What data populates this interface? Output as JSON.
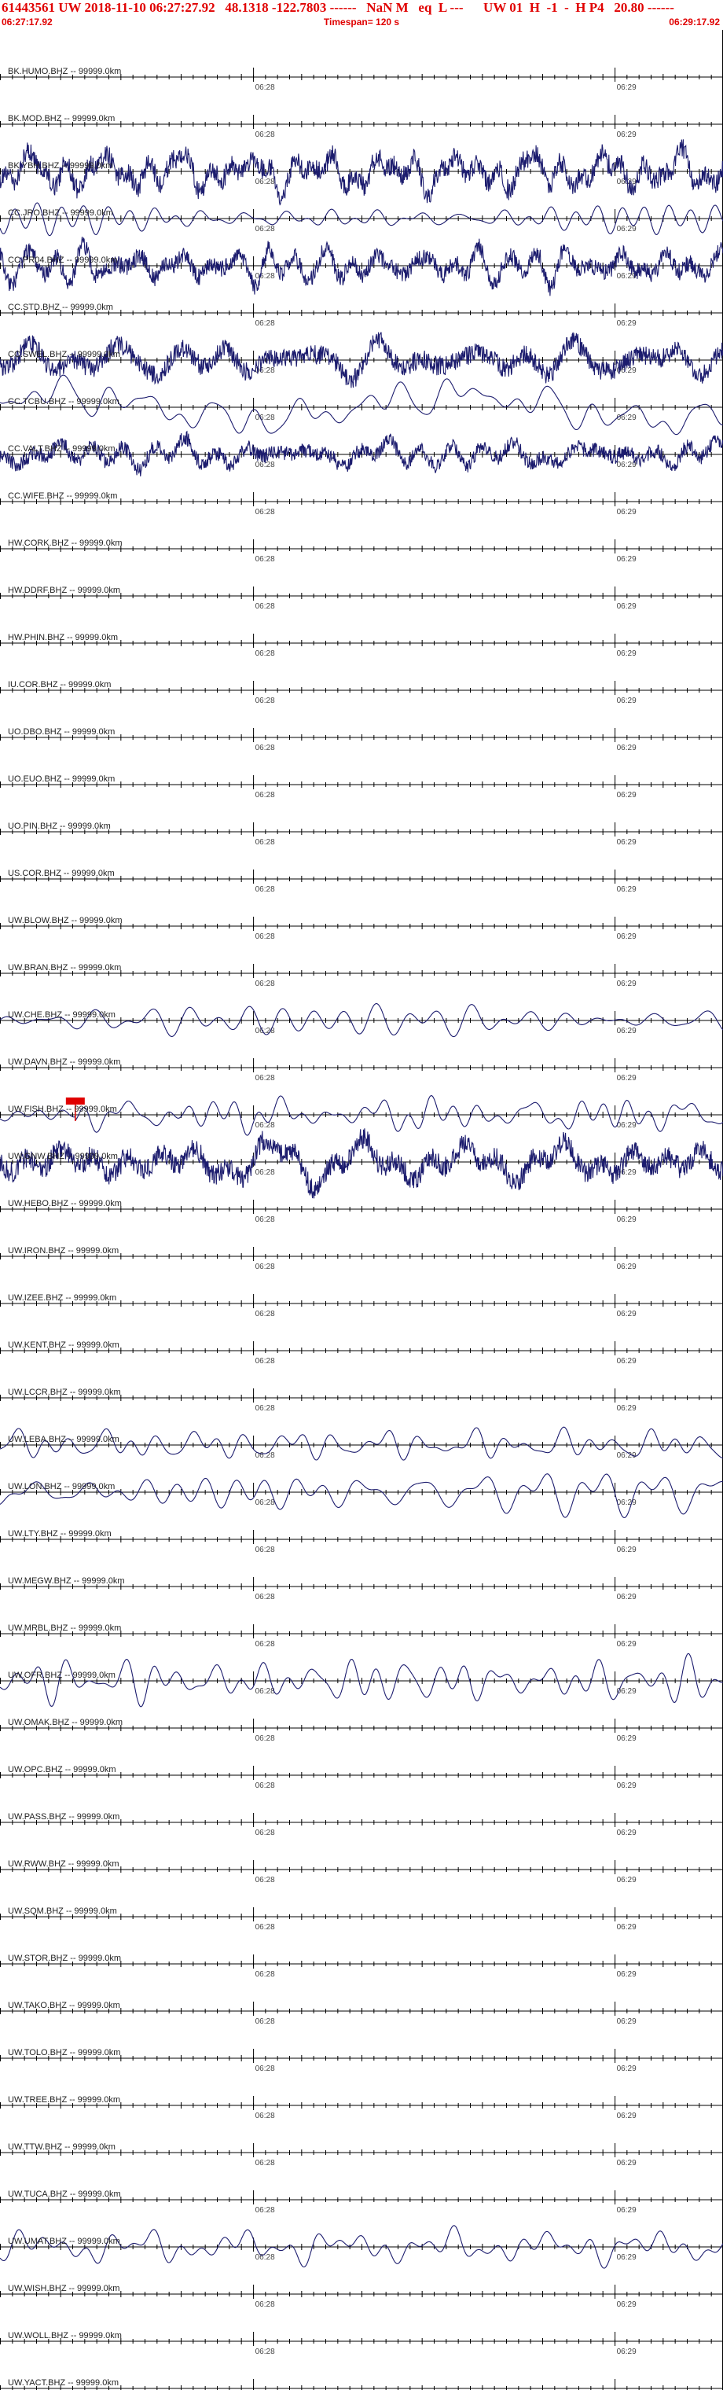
{
  "header": {
    "title": "61443561 UW 2018-11-10 06:27:27.92   48.1318 -122.7803 ------   NaN M   eq  L ---      UW 01  H  -1  -  H P4   20.80 ------",
    "start_time": "06:27:17.92",
    "end_time": "06:29:17.92",
    "timespan": "Timespan= 120 s"
  },
  "colors": {
    "header_text": "#e00000",
    "trace": "#1c1c6e",
    "axis": "#000000",
    "pick": "#e00000"
  },
  "chart_data": {
    "type": "line",
    "title": "61443561 UW 2018-11-10 06:27:27.92",
    "x_range_seconds": [
      0,
      120
    ],
    "minute_ticks": [
      {
        "label": "06:28",
        "t": 42.08
      },
      {
        "label": "06:29",
        "t": 102.08
      }
    ],
    "stations": [
      {
        "label": "BK.HUMO.BHZ -- 99999.0km",
        "has_trace": false
      },
      {
        "label": "BK.MOD.BHZ -- 99999.0km",
        "has_trace": false
      },
      {
        "label": "BK.YBH.BHZ -- 99999.0km",
        "has_trace": true,
        "amp": 0.95,
        "style": "noisy"
      },
      {
        "label": "CC.JRO.BHZ -- 99999.0km",
        "has_trace": true,
        "amp": 0.85,
        "style": "smooth"
      },
      {
        "label": "CC.PR04.BHZ -- 99999.0km",
        "has_trace": true,
        "amp": 0.8,
        "style": "noisy"
      },
      {
        "label": "CC.STD.BHZ -- 99999.0km",
        "has_trace": false
      },
      {
        "label": "CC.SWEL.BHZ -- 99999.0km",
        "has_trace": true,
        "amp": 0.9,
        "style": "noisy"
      },
      {
        "label": "CC.TCBU.BHZ -- 99999.0km",
        "has_trace": true,
        "amp": 0.9,
        "style": "wander"
      },
      {
        "label": "CC.VALT.BHZ -- 99999.0km",
        "has_trace": true,
        "amp": 0.7,
        "style": "noisy"
      },
      {
        "label": "CC.WIFE.BHZ -- 99999.0km",
        "has_trace": false
      },
      {
        "label": "HW.CORK.BHZ -- 99999.0km",
        "has_trace": false
      },
      {
        "label": "HW.DDRF.BHZ -- 99999.0km",
        "has_trace": false
      },
      {
        "label": "HW.PHIN.BHZ -- 99999.0km",
        "has_trace": false
      },
      {
        "label": "IU.COR.BHZ -- 99999.0km",
        "has_trace": false
      },
      {
        "label": "UO.DBO.BHZ -- 99999.0km",
        "has_trace": false
      },
      {
        "label": "UO.EUO.BHZ -- 99999.0km",
        "has_trace": false
      },
      {
        "label": "UO.PIN.BHZ -- 99999.0km",
        "has_trace": false
      },
      {
        "label": "US.COR.BHZ -- 99999.0km",
        "has_trace": false
      },
      {
        "label": "UW.BLOW.BHZ -- 99999.0km",
        "has_trace": false
      },
      {
        "label": "UW.BRAN.BHZ -- 99999.0km",
        "has_trace": false
      },
      {
        "label": "UW.CHE.BHZ -- 99999.0km",
        "has_trace": true,
        "amp": 0.8,
        "style": "smooth"
      },
      {
        "label": "UW.DAVN.BHZ -- 99999.0km",
        "has_trace": false
      },
      {
        "label": "UW.FISH.BHZ -- 99999.0km",
        "has_trace": true,
        "amp": 0.9,
        "style": "smooth",
        "pick": 12.5
      },
      {
        "label": "UW.GNW.BHZ -- 99999.0km",
        "has_trace": true,
        "amp": 1.0,
        "style": "noisy"
      },
      {
        "label": "UW.HEBO.BHZ -- 99999.0km",
        "has_trace": false
      },
      {
        "label": "UW.IRON.BHZ -- 99999.0km",
        "has_trace": false
      },
      {
        "label": "UW.IZEE.BHZ -- 99999.0km",
        "has_trace": false
      },
      {
        "label": "UW.KENT.BHZ -- 99999.0km",
        "has_trace": false
      },
      {
        "label": "UW.LCCR.BHZ -- 99999.0km",
        "has_trace": false
      },
      {
        "label": "UW.LEBA.BHZ -- 99999.0km",
        "has_trace": true,
        "amp": 0.8,
        "style": "smooth"
      },
      {
        "label": "UW.LON.BHZ -- 99999.0km",
        "has_trace": true,
        "amp": 0.95,
        "style": "smooth"
      },
      {
        "label": "UW.LTY.BHZ -- 99999.0km",
        "has_trace": false
      },
      {
        "label": "UW.MEGW.BHZ -- 99999.0km",
        "has_trace": false
      },
      {
        "label": "UW.MRBL.BHZ -- 99999.0km",
        "has_trace": false
      },
      {
        "label": "UW.OFR.BHZ -- 99999.0km",
        "has_trace": true,
        "amp": 0.95,
        "style": "smooth"
      },
      {
        "label": "UW.OMAK.BHZ -- 99999.0km",
        "has_trace": false
      },
      {
        "label": "UW.OPC.BHZ -- 99999.0km",
        "has_trace": false
      },
      {
        "label": "UW.PASS.BHZ -- 99999.0km",
        "has_trace": false
      },
      {
        "label": "UW.RWW.BHZ -- 99999.0km",
        "has_trace": false
      },
      {
        "label": "UW.SQM.BHZ -- 99999.0km",
        "has_trace": false
      },
      {
        "label": "UW.STOR.BHZ -- 99999.0km",
        "has_trace": false
      },
      {
        "label": "UW.TAKO.BHZ -- 99999.0km",
        "has_trace": false
      },
      {
        "label": "UW.TOLO.BHZ -- 99999.0km",
        "has_trace": false
      },
      {
        "label": "UW.TREE.BHZ -- 99999.0km",
        "has_trace": false
      },
      {
        "label": "UW.TTW.BHZ -- 99999.0km",
        "has_trace": false
      },
      {
        "label": "UW.TUCA.BHZ -- 99999.0km",
        "has_trace": false
      },
      {
        "label": "UW.UMAT.BHZ -- 99999.0km",
        "has_trace": true,
        "amp": 0.8,
        "style": "smooth"
      },
      {
        "label": "UW.WISH.BHZ -- 99999.0km",
        "has_trace": false
      },
      {
        "label": "UW.WOLL.BHZ -- 99999.0km",
        "has_trace": false
      },
      {
        "label": "UW.YACT.BHZ -- 99999.0km",
        "has_trace": false
      }
    ]
  }
}
